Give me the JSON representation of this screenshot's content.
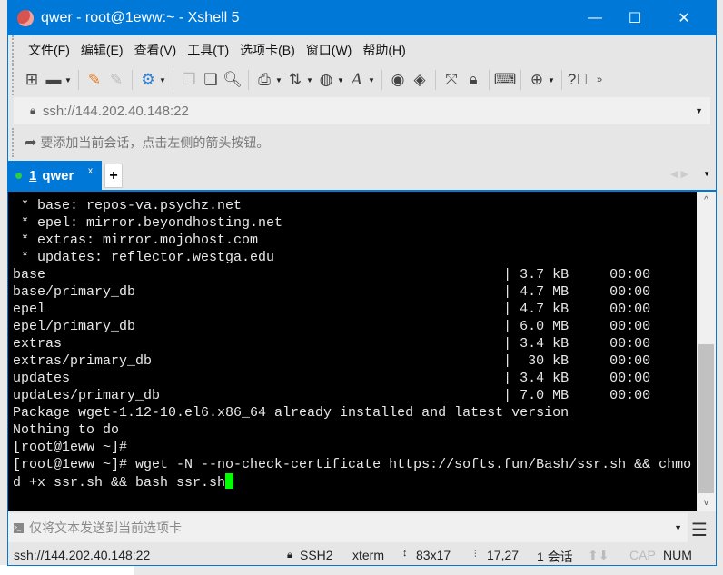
{
  "window": {
    "title": "qwer - root@1eww:~ - Xshell 5",
    "minimize": "—",
    "maximize": "☐",
    "close": "✕",
    "accent": "#0078d7"
  },
  "menu": [
    "文件(F)",
    "编辑(E)",
    "查看(V)",
    "工具(T)",
    "选项卡(B)",
    "窗口(W)",
    "帮助(H)"
  ],
  "address": {
    "value": "ssh://144.202.40.148:22"
  },
  "hint": "要添加当前会话，点击左侧的箭头按钮。",
  "tab": {
    "number": "1",
    "label": "qwer",
    "close": "x",
    "add": "+"
  },
  "terminal": {
    "mirrors": [
      " * base: repos-va.psychz.net",
      " * epel: mirror.beyondhosting.net",
      " * extras: mirror.mojohost.com",
      " * updates: reflector.westga.edu"
    ],
    "repos": [
      {
        "name": "base",
        "info": "| 3.7 kB     00:00"
      },
      {
        "name": "base/primary_db",
        "info": "| 4.7 MB     00:00"
      },
      {
        "name": "epel",
        "info": "| 4.7 kB     00:00"
      },
      {
        "name": "epel/primary_db",
        "info": "| 6.0 MB     00:00"
      },
      {
        "name": "extras",
        "info": "| 3.4 kB     00:00"
      },
      {
        "name": "extras/primary_db",
        "info": "|  30 kB     00:00"
      },
      {
        "name": "updates",
        "info": "| 3.4 kB     00:00"
      },
      {
        "name": "updates/primary_db",
        "info": "| 7.0 MB     00:00"
      }
    ],
    "lines": [
      "Package wget-1.12-10.el6.x86_64 already installed and latest version",
      "Nothing to do",
      "[root@1eww ~]#",
      "[root@1eww ~]# wget -N --no-check-certificate https://softs.fun/Bash/ssr.sh && chmo",
      "d +x ssr.sh && bash ssr.sh"
    ],
    "cursor_color": "#00ff00"
  },
  "compose": {
    "placeholder": "仅将文本发送到当前选项卡"
  },
  "status": {
    "address": "ssh://144.202.40.148:22",
    "protocol": "SSH2",
    "term": "xterm",
    "size": "83x17",
    "position": "17,27",
    "sessions": "1 会话",
    "cap": "CAP",
    "num": "NUM"
  }
}
